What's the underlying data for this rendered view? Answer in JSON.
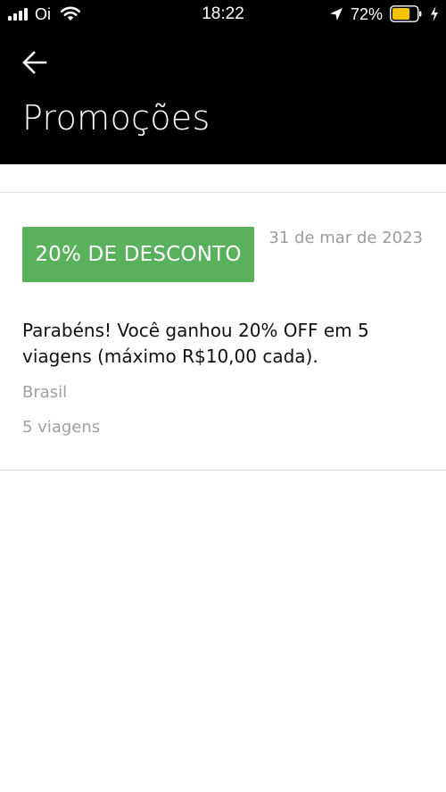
{
  "status_bar": {
    "carrier": "Oi",
    "time": "18:22",
    "battery_percent": "72%",
    "battery_level": 0.72,
    "battery_color": "#f5c400"
  },
  "header": {
    "back_icon": "arrow-left-icon",
    "title": "Promoções",
    "background": "#000000"
  },
  "promotion": {
    "badge": "20% DE DESCONTO",
    "badge_color": "#5ab15c",
    "date": "31 de mar de 2023",
    "description": "Parabéns! Você ganhou 20% OFF em 5 viagens (máximo R$10,00 cada).",
    "region": "Brasil",
    "trips": "5 viagens"
  }
}
